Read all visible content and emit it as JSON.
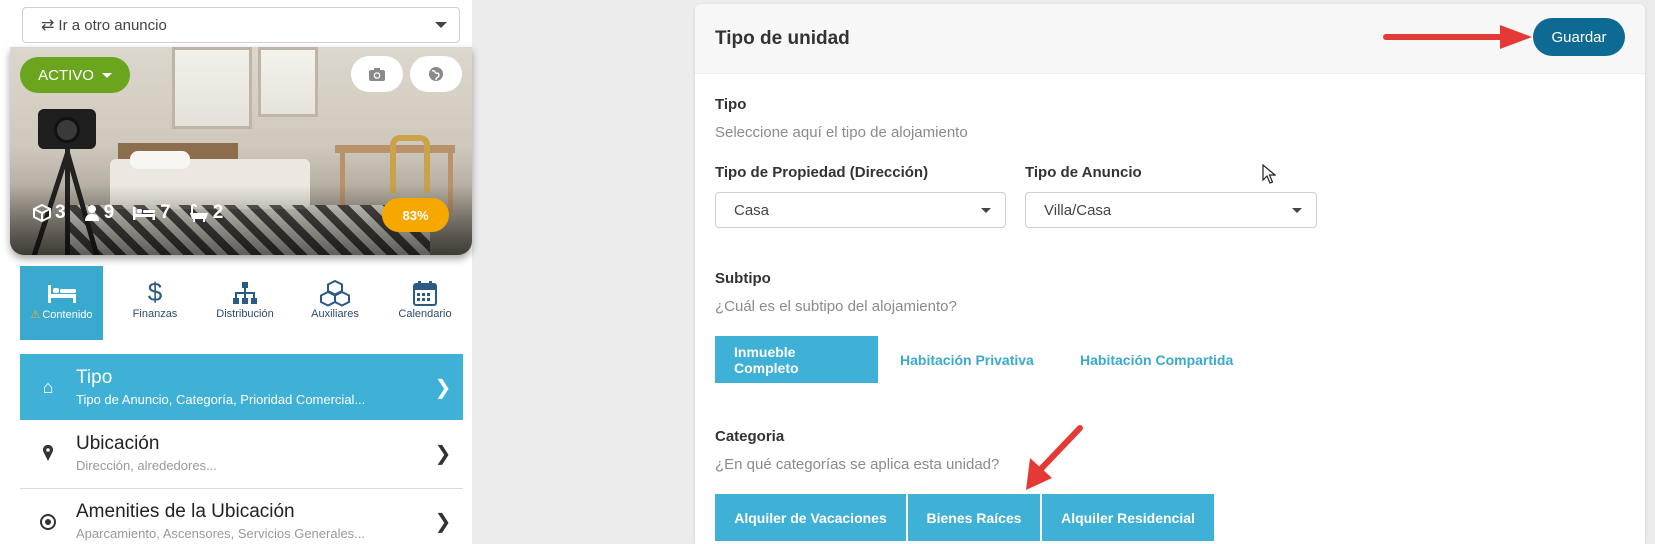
{
  "sidebar": {
    "goto_label": "Ir a otro anuncio",
    "status_label": "ACTIVO",
    "stats": {
      "units": "3",
      "guests": "9",
      "beds": "7",
      "baths": "2"
    },
    "completion": "83%",
    "tabs": [
      {
        "label": "Contenido",
        "icon": "bed-icon"
      },
      {
        "label": "Finanzas",
        "icon": "dollar-icon"
      },
      {
        "label": "Distribución",
        "icon": "sitemap-icon"
      },
      {
        "label": "Auxiliares",
        "icon": "cubes-icon"
      },
      {
        "label": "Calendario",
        "icon": "calendar-icon"
      }
    ],
    "menu": [
      {
        "title": "Tipo",
        "subtitle": "Tipo de Anuncio, Categoría, Prioridad Comercial...",
        "icon": "home-icon"
      },
      {
        "title": "Ubicación",
        "subtitle": "Dirección, alrededores...",
        "icon": "map-pin-icon"
      },
      {
        "title": "Amenities de la Ubicación",
        "subtitle": "Aparcamiento, Ascensores, Servicios Generales...",
        "icon": "target-icon"
      }
    ]
  },
  "panel": {
    "title": "Tipo de unidad",
    "save_label": "Guardar",
    "tipo": {
      "label": "Tipo",
      "hint": "Seleccione aquí el tipo de alojamiento",
      "property_label": "Tipo de Propiedad (Dirección)",
      "property_value": "Casa",
      "listing_label": "Tipo de Anuncio",
      "listing_value": "Villa/Casa"
    },
    "subtipo": {
      "label": "Subtipo",
      "hint": "¿Cuál es el subtipo del alojamiento?",
      "options": [
        "Inmueble Completo",
        "Habitación Privativa",
        "Habitación Compartida"
      ],
      "selected": "Inmueble Completo"
    },
    "categoria": {
      "label": "Categoria",
      "hint": "¿En qué categorías se aplica esta unidad?",
      "options": [
        "Alquiler de Vacaciones",
        "Bienes Raíces",
        "Alquiler Residencial"
      ]
    }
  },
  "colors": {
    "accent": "#3fb0d6",
    "save": "#0d6a93",
    "status": "#6aa51d",
    "completion": "#f6a800",
    "annotation_arrow": "#e53935"
  }
}
